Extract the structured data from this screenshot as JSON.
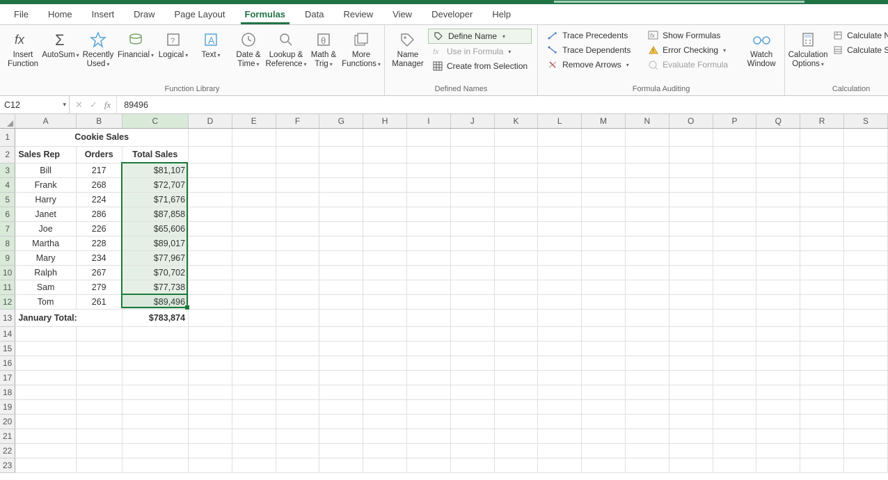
{
  "menu": {
    "items": [
      "File",
      "Home",
      "Insert",
      "Draw",
      "Page Layout",
      "Formulas",
      "Data",
      "Review",
      "View",
      "Developer",
      "Help"
    ],
    "active": "Formulas"
  },
  "ribbon": {
    "function_library": {
      "label": "Function Library",
      "insert_function": "Insert\nFunction",
      "autosum": "AutoSum",
      "recently_used": "Recently\nUsed",
      "financial": "Financial",
      "logical": "Logical",
      "text": "Text",
      "date_time": "Date &\nTime",
      "lookup_ref": "Lookup &\nReference",
      "math_trig": "Math &\nTrig",
      "more_functions": "More\nFunctions"
    },
    "defined_names": {
      "label": "Defined Names",
      "name_manager": "Name\nManager",
      "define_name": "Define Name",
      "use_in_formula": "Use in Formula",
      "create_from_selection": "Create from Selection"
    },
    "formula_auditing": {
      "label": "Formula Auditing",
      "trace_precedents": "Trace Precedents",
      "trace_dependents": "Trace Dependents",
      "remove_arrows": "Remove Arrows",
      "show_formulas": "Show Formulas",
      "error_checking": "Error Checking",
      "evaluate_formula": "Evaluate Formula",
      "watch_window": "Watch\nWindow"
    },
    "calculation": {
      "label": "Calculation",
      "calculation_options": "Calculation\nOptions",
      "calculate_now": "Calculate Now",
      "calculate_sheet": "Calculate Sheet"
    }
  },
  "formula_bar": {
    "name_box": "C12",
    "formula": "89496"
  },
  "columns": [
    "A",
    "B",
    "C",
    "D",
    "E",
    "F",
    "G",
    "H",
    "I",
    "J",
    "K",
    "L",
    "M",
    "N",
    "O",
    "P",
    "Q",
    "R",
    "S"
  ],
  "sheet": {
    "title": "Cookie Sales",
    "headers": {
      "a": "Sales Rep",
      "b": "Orders",
      "c": "Total Sales"
    },
    "rows": [
      {
        "rep": "Bill",
        "orders": "217",
        "sales": "$81,107"
      },
      {
        "rep": "Frank",
        "orders": "268",
        "sales": "$72,707"
      },
      {
        "rep": "Harry",
        "orders": "224",
        "sales": "$71,676"
      },
      {
        "rep": "Janet",
        "orders": "286",
        "sales": "$87,858"
      },
      {
        "rep": "Joe",
        "orders": "226",
        "sales": "$65,606"
      },
      {
        "rep": "Martha",
        "orders": "228",
        "sales": "$89,017"
      },
      {
        "rep": "Mary",
        "orders": "234",
        "sales": "$77,967"
      },
      {
        "rep": "Ralph",
        "orders": "267",
        "sales": "$70,702"
      },
      {
        "rep": "Sam",
        "orders": "279",
        "sales": "$77,738"
      },
      {
        "rep": "Tom",
        "orders": "261",
        "sales": "$89,496"
      }
    ],
    "total_label": "January Total:",
    "total_value": "$783,874"
  },
  "selection": {
    "range": "C3:C12",
    "active": "C12"
  }
}
